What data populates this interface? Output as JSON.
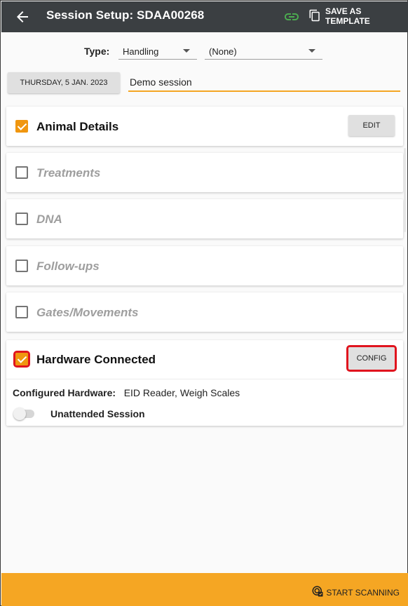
{
  "header": {
    "title": "Session Setup: SDAA00268",
    "save_template_label": "SAVE AS TEMPLATE"
  },
  "type_row": {
    "label": "Type:",
    "type_value": "Handling",
    "subtype_value": "(None)"
  },
  "session": {
    "date_label": "THURSDAY, 5 JAN. 2023",
    "name_value": "Demo session"
  },
  "sections": [
    {
      "label": "Animal Details",
      "checked": true,
      "button": "EDIT"
    },
    {
      "label": "Treatments",
      "checked": false
    },
    {
      "label": "DNA",
      "checked": false
    },
    {
      "label": "Follow-ups",
      "checked": false
    },
    {
      "label": "Gates/Movements",
      "checked": false
    }
  ],
  "hardware": {
    "label": "Hardware Connected",
    "checked": true,
    "config_button": "CONFIG",
    "configured_label": "Configured Hardware:",
    "configured_value": "EID Reader, Weigh Scales",
    "unattended_label": "Unattended Session",
    "unattended_on": false
  },
  "footer": {
    "start_label": "START SCANNING"
  },
  "colors": {
    "appbar": "#3b3f42",
    "accent": "#f5a623",
    "checkbox": "#f0960f",
    "link_icon": "#4caf50",
    "highlight": "#e0141e"
  }
}
